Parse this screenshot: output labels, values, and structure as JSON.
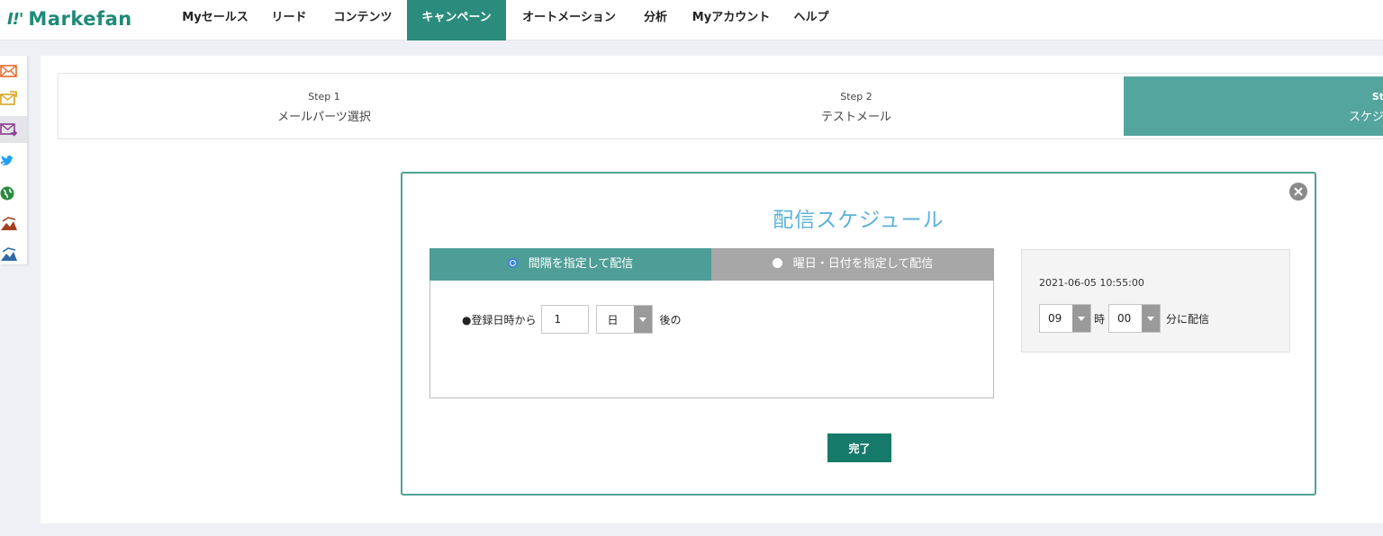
{
  "brand": {
    "mark": "I!'",
    "name": "Markefan"
  },
  "nav": {
    "items": [
      {
        "label": "Myセールス"
      },
      {
        "label": "リード"
      },
      {
        "label": "コンテンツ"
      },
      {
        "label": "キャンペーン",
        "active": true
      },
      {
        "label": "オートメーション"
      },
      {
        "label": "分析"
      },
      {
        "label": "Myアカウント"
      },
      {
        "label": "ヘルプ"
      }
    ]
  },
  "sidebar": {
    "icons": [
      "mail-icon",
      "mail-send-icon",
      "mail-forward-icon",
      "twitter-icon",
      "globe-icon",
      "landing-page-icon",
      "landing-page-alt-icon"
    ]
  },
  "steps": [
    {
      "num": "Step 1",
      "label": "メールパーツ選択"
    },
    {
      "num": "Step 2",
      "label": "テストメール"
    },
    {
      "num": "St",
      "label": "スケジ",
      "active": true
    }
  ],
  "modal": {
    "title": "配信スケジュール",
    "tab_interval": "間隔を指定して配信",
    "tab_date": "曜日・日付を指定して配信",
    "row_prefix": "●登録日時から",
    "interval_value": "1",
    "unit_value": "日",
    "row_suffix": "後の",
    "datetime": "2021-06-05 10:55:00",
    "hour_value": "09",
    "hour_label": "時",
    "minute_value": "00",
    "minute_label": "分に配信",
    "done_label": "完了"
  },
  "colors": {
    "accent": "#2b8c7e",
    "tab_active": "#4e9e97",
    "tab_inactive": "#a7a7a7",
    "title": "#5bb2d8",
    "done_button": "#157a6a"
  }
}
